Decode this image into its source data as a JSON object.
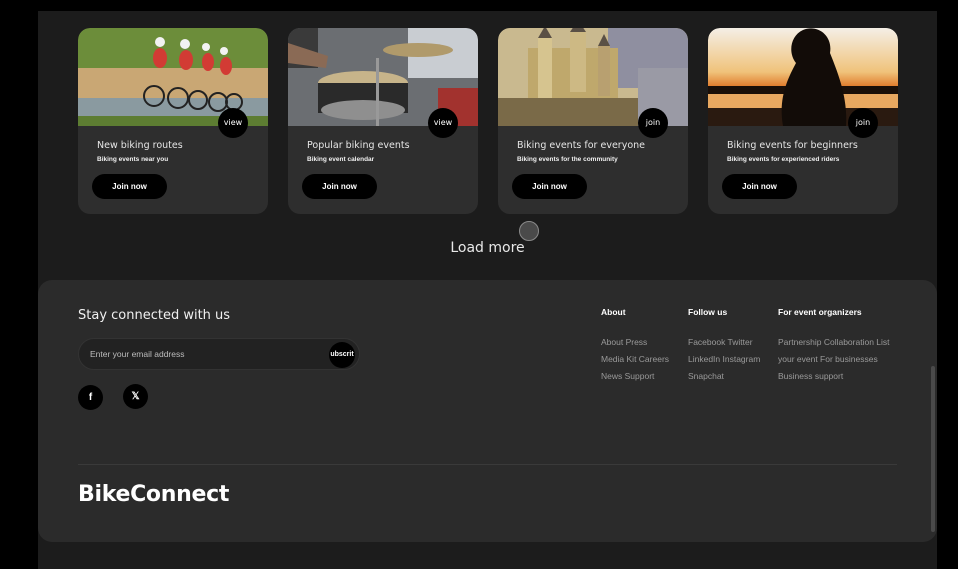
{
  "cards": [
    {
      "title": "New biking routes",
      "subtitle": "Biking events near you",
      "pill": "view",
      "button": "Join now",
      "image": "cyclists-racing-photo"
    },
    {
      "title": "Popular biking events",
      "subtitle": "Biking event calendar",
      "pill": "view",
      "button": "Join now",
      "image": "drummer-photo"
    },
    {
      "title": "Biking events for everyone",
      "subtitle": "Biking events for the community",
      "pill": "join",
      "button": "Join now",
      "image": "castle-painting-photo"
    },
    {
      "title": "Biking events for beginners",
      "subtitle": "Biking events for experienced riders",
      "pill": "join",
      "button": "Join now",
      "image": "sunset-silhouette-photo"
    }
  ],
  "load_more": "Load more",
  "footer": {
    "stay_connected": "Stay connected with us",
    "email_placeholder": "Enter your email address",
    "subscribe_label": "ubscrit",
    "social": [
      {
        "icon": "facebook-icon",
        "glyph": "f"
      },
      {
        "icon": "x-twitter-icon",
        "glyph": "𝕏"
      }
    ],
    "columns": [
      {
        "heading": "About",
        "links": [
          "About Press",
          "Media Kit Careers",
          "News Support"
        ]
      },
      {
        "heading": "Follow us",
        "links": [
          "Facebook Twitter",
          "LinkedIn Instagram",
          "Snapchat"
        ]
      },
      {
        "heading": "For event organizers",
        "links": [
          "Partnership Collaboration List",
          "your event For businesses",
          "Business support"
        ]
      }
    ],
    "brand": "BikeConnect"
  },
  "colors": {
    "background": "#000000",
    "page": "#1c1c1c",
    "card": "#2e2e2e",
    "footer": "#2b2b2b",
    "button": "#000000"
  }
}
